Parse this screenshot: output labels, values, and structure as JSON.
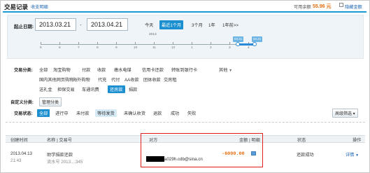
{
  "header": {
    "title": "交易记录",
    "collapse_link": "收支明细",
    "balance_label": "可用余额",
    "balance_value": "55.96 元",
    "hide_label": "隐藏金额"
  },
  "date": {
    "label": "起止日期:",
    "from": "2013.03.21",
    "dash": "-",
    "to": "2013.04.21",
    "quick": [
      "今天",
      "最近1个月",
      "3个月",
      "1年",
      "1年前>>"
    ],
    "timeline_year": "2013",
    "timeline_months": [
      "5",
      "6",
      "7",
      "8",
      "9",
      "10",
      "11",
      "12",
      "1",
      "2",
      "3",
      "4"
    ],
    "handle_from": "03.21",
    "handle_to": "04.21"
  },
  "filters": {
    "category_label": "交易分类:",
    "row1": [
      "全部",
      "淘宝购物",
      "付款",
      "收款",
      "缴水电煤",
      "信用卡还款",
      "转账到银行卡"
    ],
    "other": "其他",
    "other_arrow": "▼",
    "row2": [
      "国内其他网页购物",
      "海外购物",
      "代充",
      "代付",
      "AA收款",
      "团体收款",
      "交房租"
    ],
    "row3": [
      "送礼金",
      "担保交易",
      "车通讯费",
      "还房款",
      "捐款"
    ],
    "custom_label": "自定义分类:",
    "custom_button": "管理分类",
    "status_label": "交易状态:",
    "status_items": [
      "全部",
      "进行中",
      "未付款",
      "等待发货",
      "未确认收货",
      "退款",
      "成功",
      "失败"
    ],
    "advanced_button": "高级筛选 ▾"
  },
  "table": {
    "headers": {
      "time": "创建时间",
      "name": "名称 | 交易号",
      "party": "对方",
      "amount": "金额 | 明细",
      "status": "状态",
      "action": "操作"
    },
    "rows": [
      {
        "date": "2013.04.13",
        "time": "21:43",
        "name": "助学捐款还款",
        "serial": "流水号 2013....345",
        "party": "a029h.cdb@sina.cn",
        "amount": "-6000.00",
        "status": "还款成功",
        "action": "详情",
        "action_caret": "▼"
      }
    ]
  }
}
